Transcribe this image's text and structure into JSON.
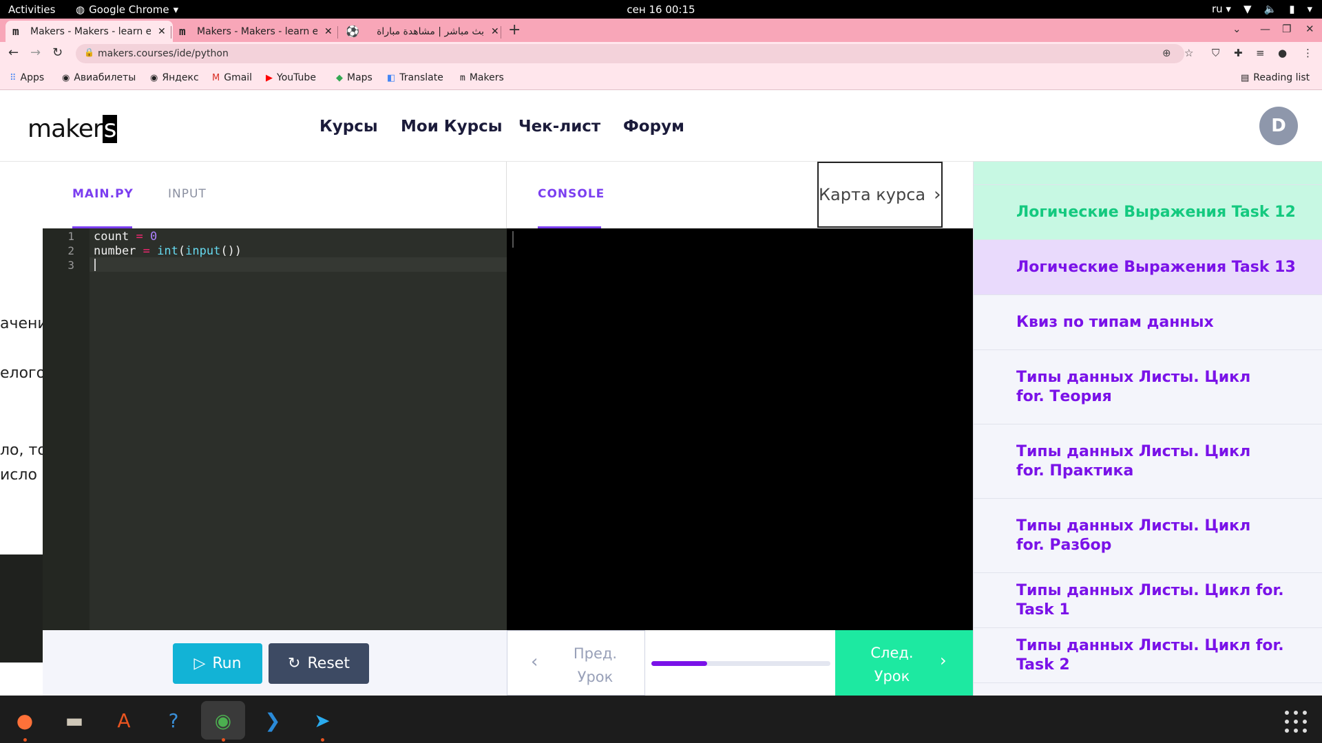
{
  "system_bar": {
    "activities": "Activities",
    "app_name": "Google Chrome",
    "clock": "сен 16  00:15",
    "lang": "ru"
  },
  "tabs": [
    {
      "favicon": "m",
      "title": "Makers - Makers - learn every",
      "active": true
    },
    {
      "favicon": "m",
      "title": "Makers - Makers - learn every",
      "active": false
    },
    {
      "favicon": "soccer-icon",
      "title": "بث مباشر | مشاهدة مباراة",
      "active": false
    }
  ],
  "address_bar": {
    "url": "makers.courses/ide/python"
  },
  "bookmarks": [
    {
      "icon": "apps-grid-icon",
      "label": "Apps"
    },
    {
      "icon": "globe-icon",
      "label": "Авиабилеты"
    },
    {
      "icon": "globe-icon",
      "label": "Яндекс"
    },
    {
      "icon": "gmail-icon",
      "label": "Gmail"
    },
    {
      "icon": "youtube-icon",
      "label": "YouTube"
    },
    {
      "icon": "maps-icon",
      "label": "Maps"
    },
    {
      "icon": "translate-icon",
      "label": "Translate"
    },
    {
      "icon": "makers-icon",
      "label": "Makers"
    }
  ],
  "reading_list": "Reading list",
  "site": {
    "logo_main": "make",
    "logo_r": "r",
    "logo_s": "s",
    "nav": [
      "Курсы",
      "Мои Курсы",
      "Чек-лист",
      "Форум"
    ],
    "avatar_letter": "D"
  },
  "editor": {
    "tab_main": "MAIN.PY",
    "tab_input": "INPUT",
    "lines": [
      "1",
      "2",
      "3"
    ],
    "code": {
      "l1_var": "count",
      "l1_op": "=",
      "l1_val": "0",
      "l2_var": "number",
      "l2_op": "=",
      "l2_fn1": "int",
      "l2_p1": "(",
      "l2_fn2": "input",
      "l2_p2": "())"
    },
    "run_label": "Run",
    "reset_label": "Reset"
  },
  "console": {
    "tab_label": "CONSOLE",
    "course_map_label": "Карта курса"
  },
  "lesson_text_fragments": [
    "ачени",
    "елого",
    "ло, то",
    "исло и"
  ],
  "navigation": {
    "prev_line1": "Пред.",
    "prev_line2": "Урок",
    "next_line1": "След.",
    "next_line2": "Урок",
    "progress_fraction": 0.31
  },
  "lessons": [
    {
      "title": "Логические Выражения Task 12",
      "state": "done"
    },
    {
      "title": "Логические Выражения Task 13",
      "state": "current"
    },
    {
      "title": "Квиз по типам данных",
      "state": "todo"
    },
    {
      "title": "Типы данных Листы. Цикл for. Теория",
      "state": "todo"
    },
    {
      "title": "Типы данных Листы. Цикл for. Практика",
      "state": "todo"
    },
    {
      "title": "Типы данных Листы. Цикл for. Разбор",
      "state": "todo"
    },
    {
      "title": "Типы данных Листы. Цикл for. Task 1",
      "state": "todo"
    },
    {
      "title": "Типы данных Листы. Цикл for. Task 2",
      "state": "todo"
    }
  ],
  "colors": {
    "accent_purple": "#7a12e8",
    "run_blue": "#12b3d6",
    "next_green": "#1de9a1",
    "done_green": "#14c97f"
  }
}
